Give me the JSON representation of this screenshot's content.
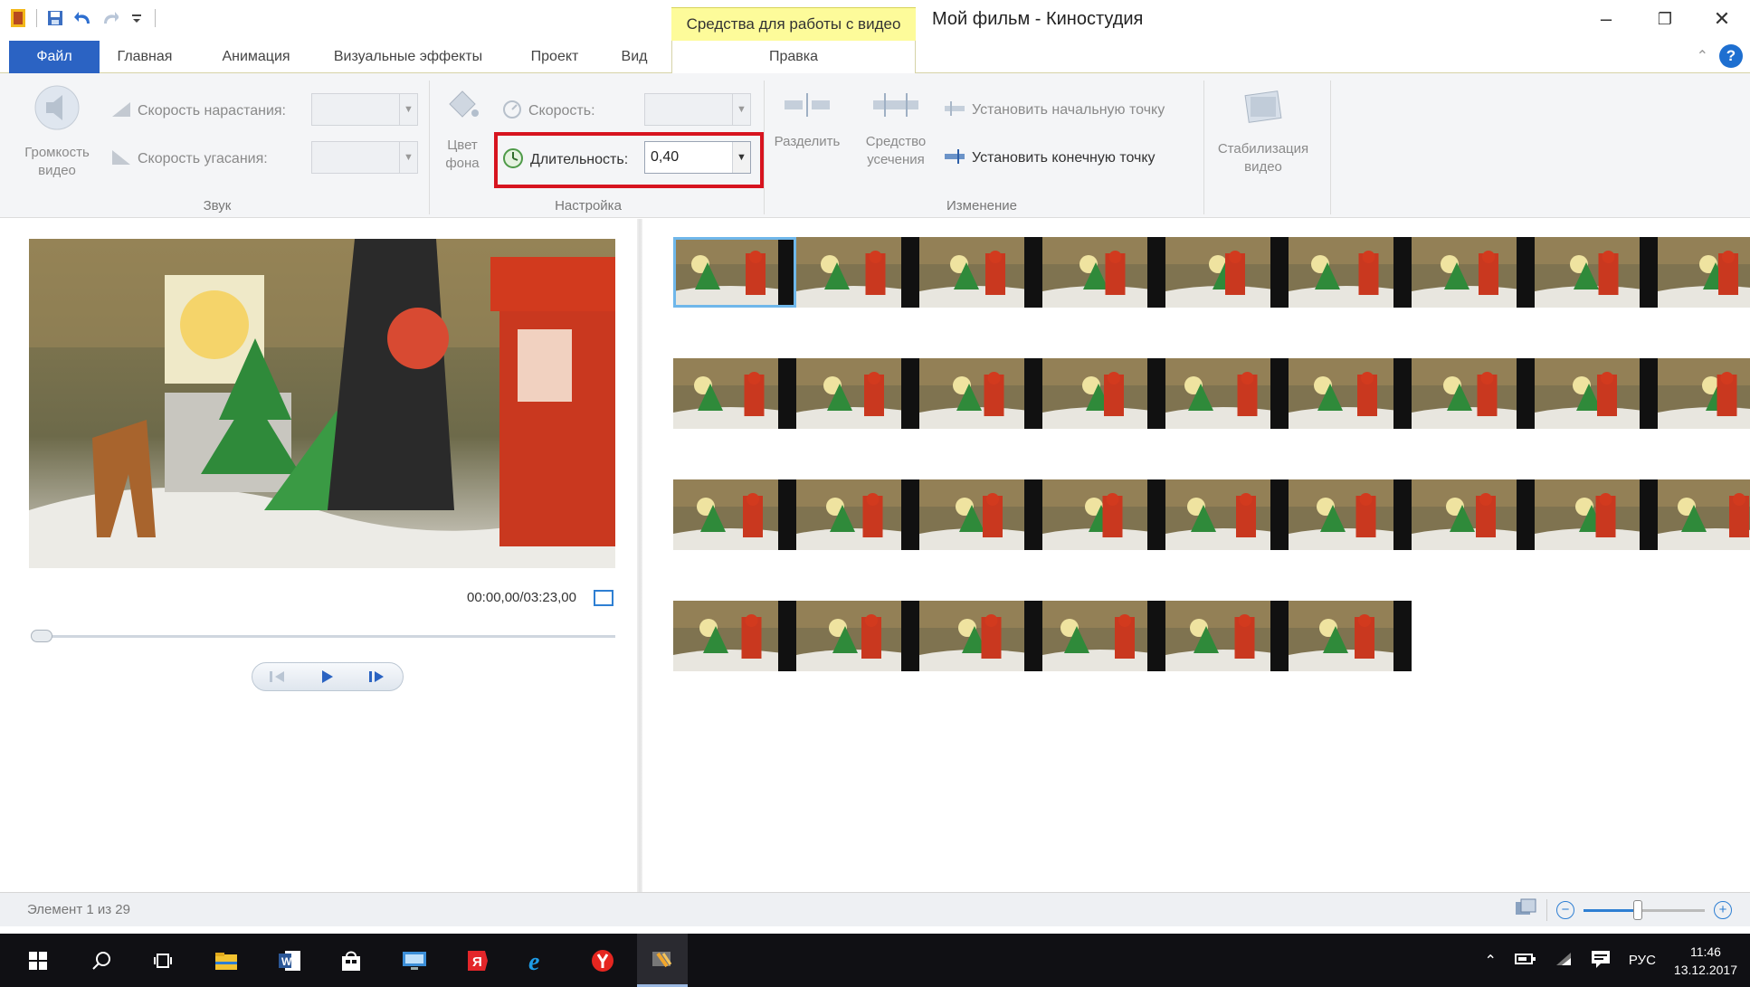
{
  "titlebar": {
    "context_tab_title": "Средства для работы с видео",
    "window_title": "Мой фильм - Киностудия",
    "minimize": "–",
    "restore": "❐",
    "close": "✕"
  },
  "tabs": {
    "file": "Файл",
    "home": "Главная",
    "animation": "Анимация",
    "visual_effects": "Визуальные эффекты",
    "project": "Проект",
    "view": "Вид",
    "edit": "Правка"
  },
  "ribbon": {
    "sound": {
      "volume_line1": "Громкость",
      "volume_line2": "видео",
      "fade_in_label": "Скорость нарастания:",
      "fade_out_label": "Скорость угасания:",
      "group_label": "Звук"
    },
    "settings": {
      "bg_color_line1": "Цвет",
      "bg_color_line2": "фона",
      "speed_label": "Скорость:",
      "duration_label": "Длительность:",
      "duration_value": "0,40",
      "group_label": "Настройка"
    },
    "edit": {
      "split": "Разделить",
      "trim_line1": "Средство",
      "trim_line2": "усечения",
      "set_start": "Установить начальную точку",
      "set_end": "Установить конечную точку",
      "group_label": "Изменение"
    },
    "stabilize": {
      "line1": "Стабилизация",
      "line2": "видео"
    }
  },
  "preview": {
    "time": "00:00,00/03:23,00"
  },
  "storyboard": {
    "rows": [
      9,
      9,
      9,
      6
    ],
    "selected_index": 0
  },
  "status": {
    "element_text": "Элемент 1 из 29",
    "zoom_minus": "−",
    "zoom_plus": "+",
    "zoom_level": 0.45
  },
  "taskbar": {
    "language": "РУС",
    "time": "11:46",
    "date": "13.12.2017"
  },
  "colors": {
    "file_tab": "#2b63c3",
    "context_tab": "#fdfb9a",
    "highlight": "#d7141f",
    "selection": "#6fb7ea"
  }
}
